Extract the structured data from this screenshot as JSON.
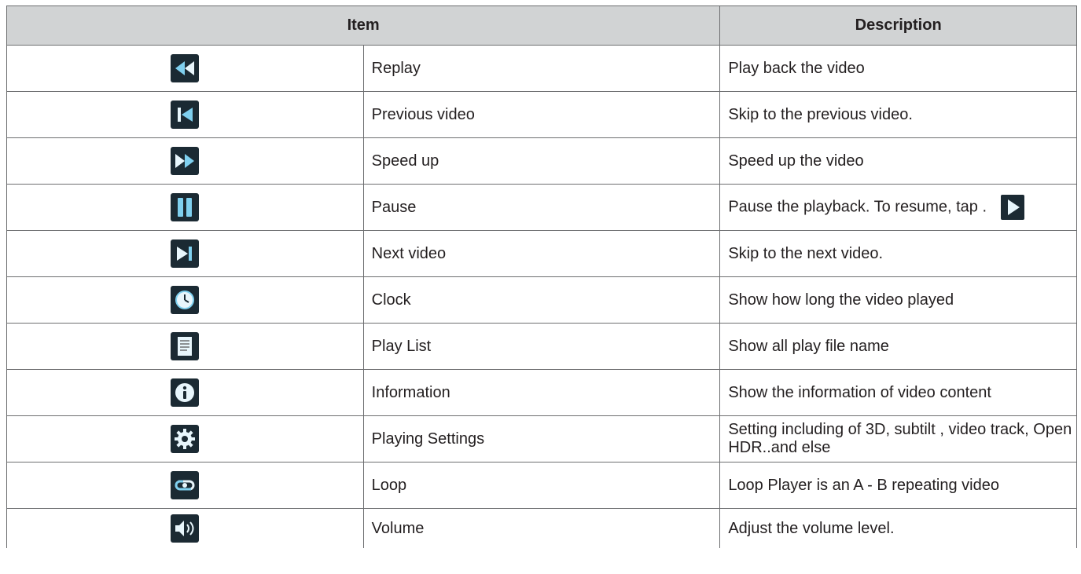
{
  "header": {
    "item": "Item",
    "description": "Description"
  },
  "rows": [
    {
      "icon": "replay-icon",
      "name": "Replay",
      "description": "Play back the video"
    },
    {
      "icon": "previous-icon",
      "name": "Previous video",
      "description": "Skip to the previous video."
    },
    {
      "icon": "fast-forward-icon",
      "name": "Speed up",
      "description": "Speed up the video"
    },
    {
      "icon": "pause-icon",
      "name": "Pause",
      "description": "Pause the playback. To resume, tap .",
      "inline_icon": "play-icon"
    },
    {
      "icon": "next-icon",
      "name": "Next video",
      "description": "Skip to the next video."
    },
    {
      "icon": "clock-icon",
      "name": "Clock",
      "description": "Show how long the video played"
    },
    {
      "icon": "playlist-icon",
      "name": "Play List",
      "description": "Show all play file name"
    },
    {
      "icon": "info-icon",
      "name": "Information",
      "description": "Show the information of video content"
    },
    {
      "icon": "gear-icon",
      "name": "Playing Settings",
      "description": "Setting including of 3D, subtilt , video track, Open HDR..and else"
    },
    {
      "icon": "loop-icon",
      "name": "Loop",
      "description": "Loop Player is an A - B repeating video"
    },
    {
      "icon": "volume-icon",
      "name": "Volume",
      "description": "Adjust the volume level."
    }
  ],
  "colors": {
    "header_bg": "#d1d3d4",
    "border": "#6d6e70",
    "text": "#231f20",
    "icon_dark": "#1b2a33",
    "icon_accent": "#6fc3e8"
  }
}
